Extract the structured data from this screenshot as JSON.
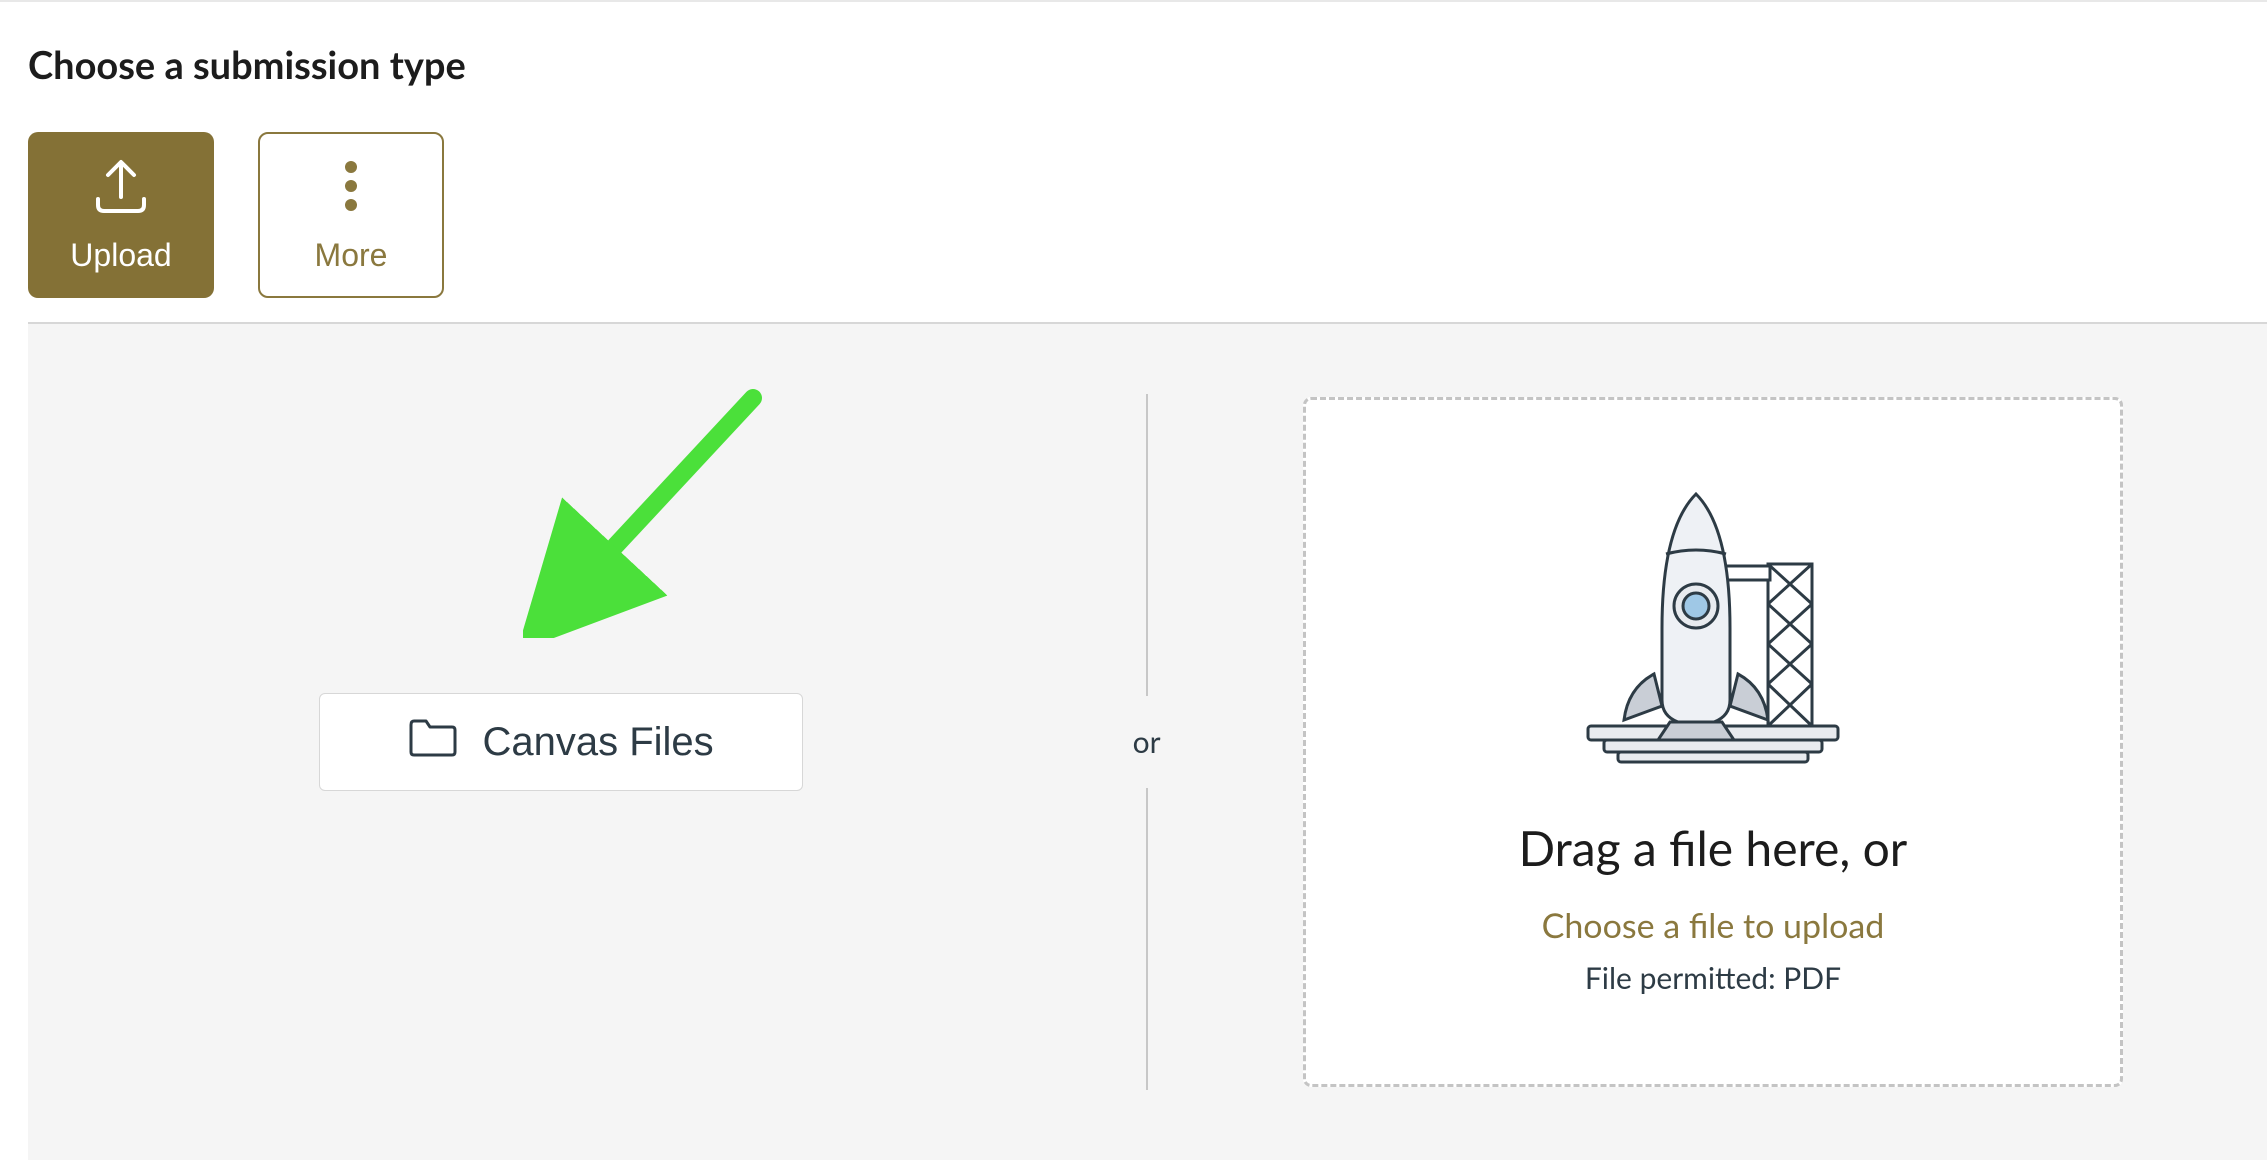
{
  "heading": "Choose a submission type",
  "tabs": {
    "upload_label": "Upload",
    "more_label": "More"
  },
  "canvas_files_label": "Canvas Files",
  "or_label": "or",
  "dropzone": {
    "drag_text": "Drag a file here, or",
    "choose_link": "Choose a file to upload",
    "permitted_text": "File permitted: PDF"
  },
  "annotation": {
    "arrow_color": "#4be03a"
  }
}
